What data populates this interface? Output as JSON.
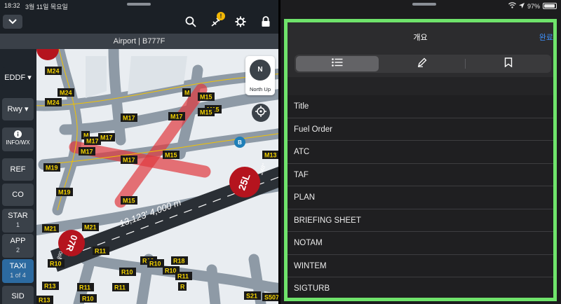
{
  "left_pane": {
    "status": {
      "time": "18:32",
      "date": "3월 11일 목요일"
    },
    "toolbar": {
      "alert_count": "!"
    },
    "title": "Airport | B777F",
    "sidebar": {
      "airport": "EDDF",
      "rwy": "Rwy",
      "info_label": "INFO/WX",
      "buttons": [
        {
          "label": "REF",
          "sub": ""
        },
        {
          "label": "CO",
          "sub": ""
        },
        {
          "label": "STAR",
          "sub": "1"
        },
        {
          "label": "APP",
          "sub": "2"
        },
        {
          "label": "TAXI",
          "sub": "1 of 4"
        },
        {
          "label": "SID",
          "sub": ""
        }
      ]
    },
    "map": {
      "north_up_label": "North Up",
      "compass_letter": "N",
      "runway_25L": "25L",
      "runway_07R": "07R",
      "runway_25L_heading": "248°",
      "runway_07R_heading": "068°",
      "runway_dims": "13,123' 4,000 m",
      "taxiway_labels": [
        "M24",
        "M24",
        "M24",
        "M",
        "M15",
        "M15",
        "M15",
        "M",
        "M17",
        "M17",
        "M17",
        "M17",
        "M17",
        "M15",
        "M17",
        "M19",
        "M19",
        "M21",
        "M21",
        "M15",
        "M13",
        "R10",
        "R11",
        "R10",
        "R10",
        "R10",
        "R18",
        "R10",
        "R13",
        "R11",
        "R11",
        "R11",
        "R13",
        "R10",
        "R",
        "S21",
        "S507"
      ]
    },
    "colors": {
      "route": "#e0393e",
      "taxiway_label_bg": "#1a1a1a",
      "taxiway_label_text": "#f2d100",
      "runway": "#2a2f35"
    }
  },
  "right_pane": {
    "status": {
      "battery": "97%"
    },
    "sheet": {
      "title": "개요",
      "done": "완료",
      "tabs": [
        {
          "icon": "list-icon",
          "selected": true
        },
        {
          "icon": "pencil-icon",
          "selected": false
        },
        {
          "icon": "bookmark-icon",
          "selected": false
        }
      ],
      "items": [
        "Title",
        "Fuel Order",
        "ATC",
        "TAF",
        "PLAN",
        "BRIEFING SHEET",
        "NOTAM",
        "WINTEM",
        "SIGTURB"
      ]
    },
    "colors": {
      "highlight_border": "#6fe36b",
      "accent": "#3e8ef7"
    }
  }
}
